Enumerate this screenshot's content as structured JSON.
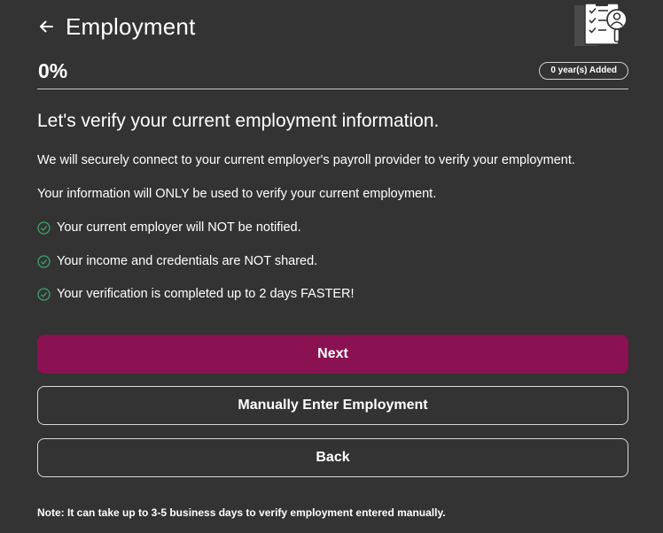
{
  "header": {
    "title": "Employment",
    "back_icon": "arrow-left-icon",
    "illustration_icon": "checklist-person-icon"
  },
  "progress": {
    "percent_label": "0%",
    "years_added_label": "0 year(s) Added"
  },
  "content": {
    "heading": "Let's verify your current employment information.",
    "paragraph_1": "We will securely connect to your current employer's payroll provider to verify your employment.",
    "paragraph_2": "Your information will ONLY be used to verify your current employment.",
    "checklist": [
      {
        "text": "Your current employer will NOT be notified.",
        "icon": "check-circle-icon"
      },
      {
        "text": "Your income and credentials are NOT shared.",
        "icon": "check-circle-icon"
      },
      {
        "text": "Your verification is completed up to 2 days FASTER!",
        "icon": "check-circle-icon"
      }
    ]
  },
  "buttons": {
    "next": "Next",
    "manual": "Manually Enter Employment",
    "back": "Back"
  },
  "note": "Note: It can take up to 3-5 business days to verify employment entered manually.",
  "colors": {
    "background": "#333333",
    "primary": "#8a1152",
    "check_green": "#3fa46a"
  }
}
